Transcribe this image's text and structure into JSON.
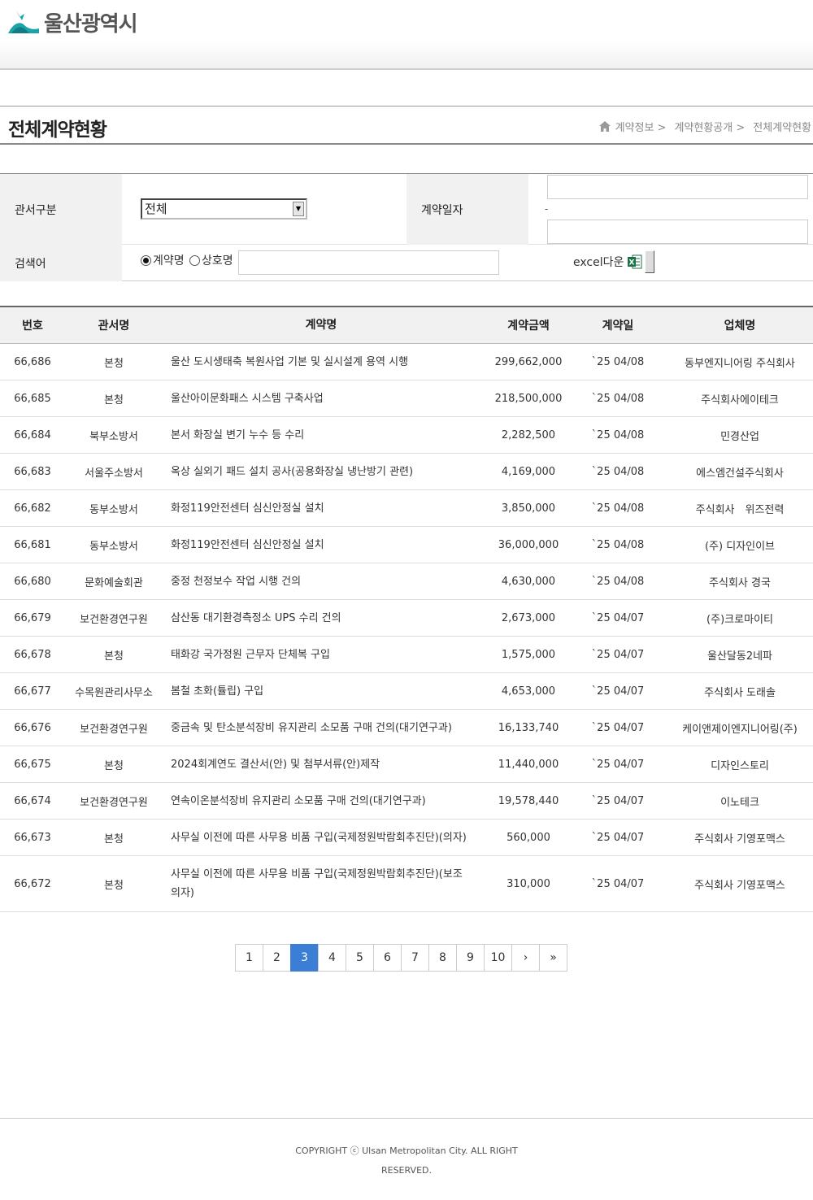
{
  "header": {
    "logo_text": "울산광역시"
  },
  "page": {
    "title": "전체계약현황",
    "breadcrumb": [
      "계약정보 >",
      "계약현황공개 >",
      "전체계약현황"
    ]
  },
  "search": {
    "dept_label": "관서구분",
    "dept_value": "전체",
    "date_label": "계약일자",
    "date_sep": "-",
    "keyword_label": "검색어",
    "radio_contract": "계약명",
    "radio_company": "상호명",
    "excel_label": "excel다운"
  },
  "table": {
    "headers": [
      "번호",
      "관서명",
      "계약명",
      "계약금액",
      "계약일",
      "업체명"
    ],
    "rows": [
      [
        "66,686",
        "본청",
        "울산 도시생태축 복원사업 기본 및 실시설계 용역 시행",
        "299,662,000",
        "`25 04/08",
        "동부엔지니어링 주식회사"
      ],
      [
        "66,685",
        "본청",
        "울산아이문화패스 시스템 구축사업",
        "218,500,000",
        "`25 04/08",
        "주식회사에이테크"
      ],
      [
        "66,684",
        "북부소방서",
        "본서 화장실 변기 누수 등 수리",
        "2,282,500",
        "`25 04/08",
        "민경산업"
      ],
      [
        "66,683",
        "서울주소방서",
        "옥상 실외기 패드 설치 공사(공용화장실 냉난방기 관련)",
        "4,169,000",
        "`25 04/08",
        "에스엠건설주식회사"
      ],
      [
        "66,682",
        "동부소방서",
        "화정119안전센터 심신안정실 설치",
        "3,850,000",
        "`25 04/08",
        "주식회사　위즈전력"
      ],
      [
        "66,681",
        "동부소방서",
        "화정119안전센터 심신안정실 설치",
        "36,000,000",
        "`25 04/08",
        "(주) 디자인이브"
      ],
      [
        "66,680",
        "문화예술회관",
        "중정 천정보수 작업 시행 건의",
        "4,630,000",
        "`25 04/08",
        "주식회사 경국"
      ],
      [
        "66,679",
        "보건환경연구원",
        "삼산동 대기환경측정소 UPS 수리 건의",
        "2,673,000",
        "`25 04/07",
        "(주)크로마이티"
      ],
      [
        "66,678",
        "본청",
        "태화강 국가정원 근무자 단체복 구입",
        "1,575,000",
        "`25 04/07",
        "울산달동2네파"
      ],
      [
        "66,677",
        "수목원관리사무소",
        "봄철 초화(튤립) 구입",
        "4,653,000",
        "`25 04/07",
        "주식회사 도래솔"
      ],
      [
        "66,676",
        "보건환경연구원",
        "중금속 및 탄소분석장비 유지관리 소모품 구매 건의(대기연구과)",
        "16,133,740",
        "`25 04/07",
        "케이앤제이엔지니어링(주)"
      ],
      [
        "66,675",
        "본청",
        "2024회계연도 결산서(안) 및 첨부서류(안)제작",
        "11,440,000",
        "`25 04/07",
        "디자인스토리"
      ],
      [
        "66,674",
        "보건환경연구원",
        "연속이온분석장비 유지관리 소모품 구매 건의(대기연구과)",
        "19,578,440",
        "`25 04/07",
        "이노테크"
      ],
      [
        "66,673",
        "본청",
        "사무실 이전에 따른 사무용 비품 구입(국제정원박람회추진단)(의자)",
        "560,000",
        "`25 04/07",
        "주식회사 기영포맥스"
      ],
      [
        "66,672",
        "본청",
        "사무실 이전에 따른 사무용 비품 구입(국제정원박람회추진단)(보조의자)",
        "310,000",
        "`25 04/07",
        "주식회사 기영포맥스"
      ]
    ]
  },
  "pagination": {
    "pages": [
      "1",
      "2",
      "3",
      "4",
      "5",
      "6",
      "7",
      "8",
      "9",
      "10"
    ],
    "current": "3",
    "next": "›",
    "last": "»"
  },
  "footer": {
    "copyright": "COPYRIGHT ⓒ Ulsan Metropolitan City. ALL RIGHT RESERVED."
  },
  "colors": {
    "accent": "#3a7fd5",
    "logo_teal": "#1aa3a8"
  }
}
